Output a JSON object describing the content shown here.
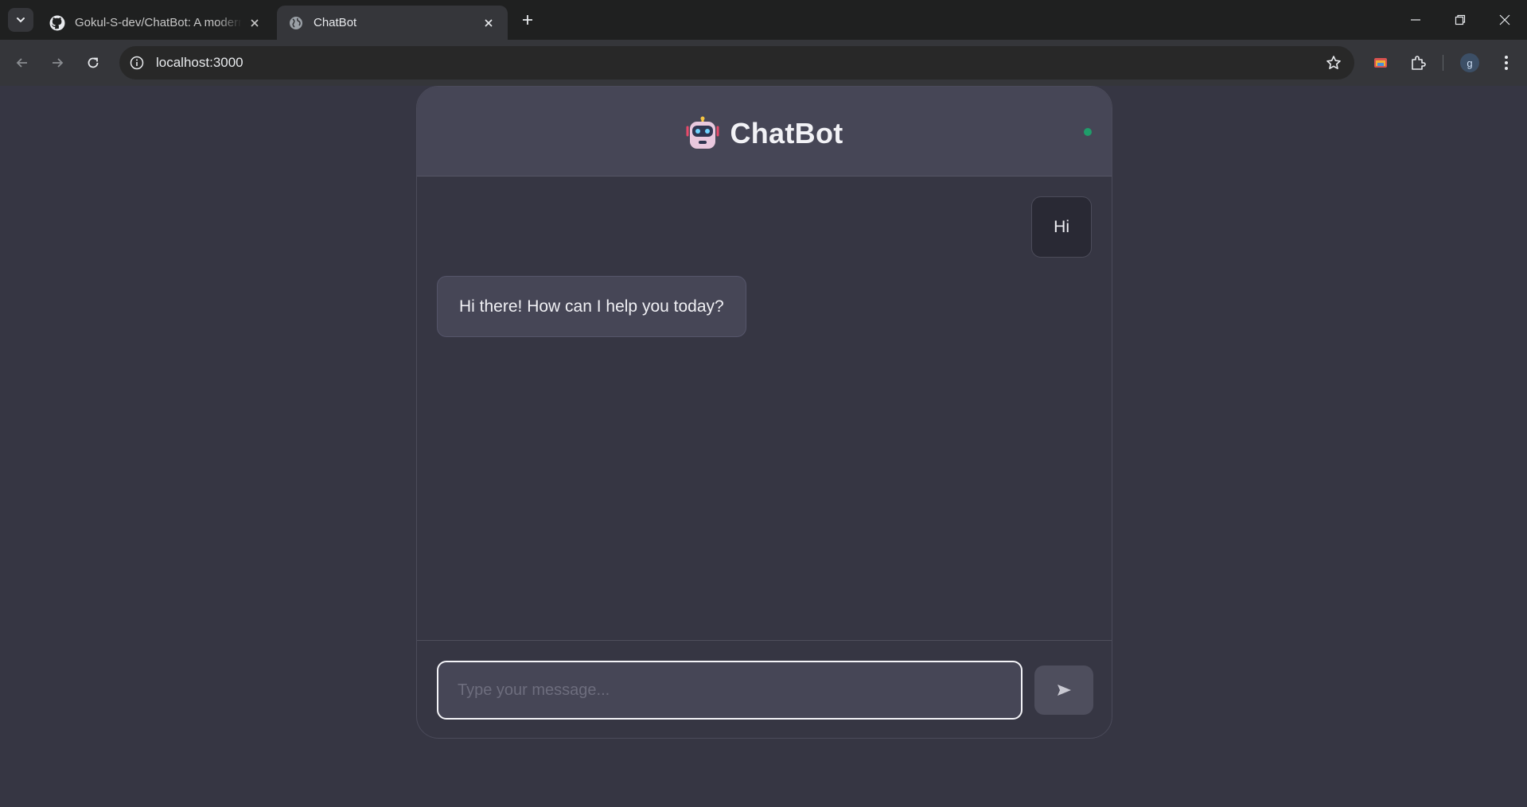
{
  "browser": {
    "tabs": [
      {
        "title": "Gokul-S-dev/ChatBot: A modern",
        "favicon": "github-icon",
        "active": false
      },
      {
        "title": "ChatBot",
        "favicon": "globe-icon",
        "active": true
      }
    ],
    "address": {
      "url": "localhost:3000"
    },
    "profile_initial": "g"
  },
  "chat": {
    "title": "ChatBot",
    "status": "online",
    "messages": [
      {
        "role": "user",
        "text": "Hi"
      },
      {
        "role": "bot",
        "text": "Hi there! How can I help you today?"
      }
    ],
    "input": {
      "value": "",
      "placeholder": "Type your message..."
    },
    "send_icon": "send-arrow-icon"
  },
  "colors": {
    "page_bg": "#363643",
    "header_bg": "#464656",
    "status_online": "#1f9d6a",
    "user_bubble": "#292934",
    "bot_bubble": "#464656"
  }
}
